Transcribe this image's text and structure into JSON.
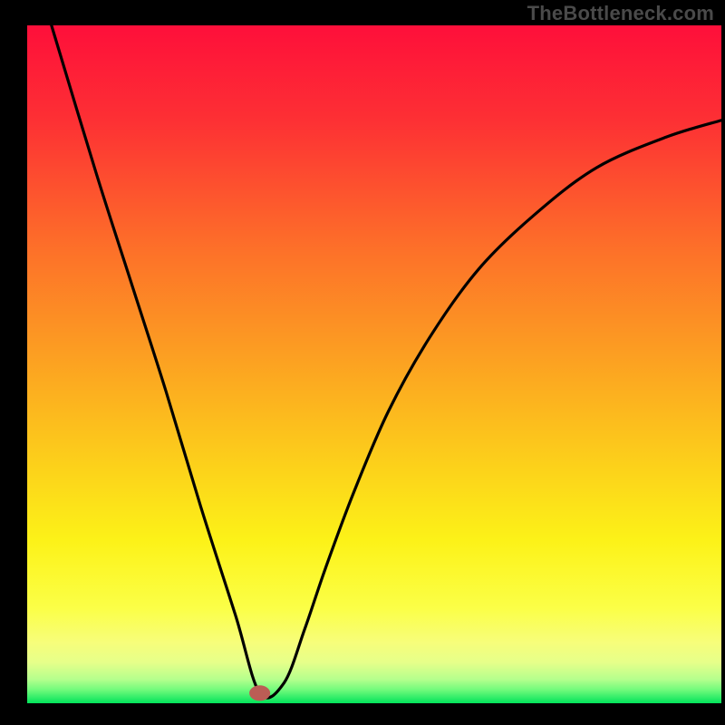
{
  "watermark": "TheBottleneck.com",
  "chart_data": {
    "type": "line",
    "title": "",
    "xlabel": "",
    "ylabel": "",
    "xlim": [
      0,
      100
    ],
    "ylim": [
      0,
      100
    ],
    "grid": false,
    "legend": false,
    "series": [
      {
        "name": "curve",
        "x": [
          3.5,
          10,
          15,
          20,
          25,
          30,
          33.5,
          37,
          40,
          43,
          47,
          52,
          58,
          65,
          73,
          82,
          92,
          100
        ],
        "values": [
          100,
          78,
          62,
          46,
          29,
          13,
          1.5,
          3,
          11,
          20,
          31,
          43,
          54,
          64,
          72,
          79,
          83.5,
          86
        ]
      }
    ],
    "marker": {
      "x": 33.5,
      "y": 1.5
    },
    "gradient_bands": [
      {
        "y": 100,
        "color": "#fe0f3a"
      },
      {
        "y": 50,
        "color": "#fca321"
      },
      {
        "y": 25,
        "color": "#fcf218"
      },
      {
        "y": 10,
        "color": "#f7fe7a"
      },
      {
        "y": 4,
        "color": "#c1ff8f"
      },
      {
        "y": 0,
        "color": "#02e35b"
      }
    ]
  }
}
